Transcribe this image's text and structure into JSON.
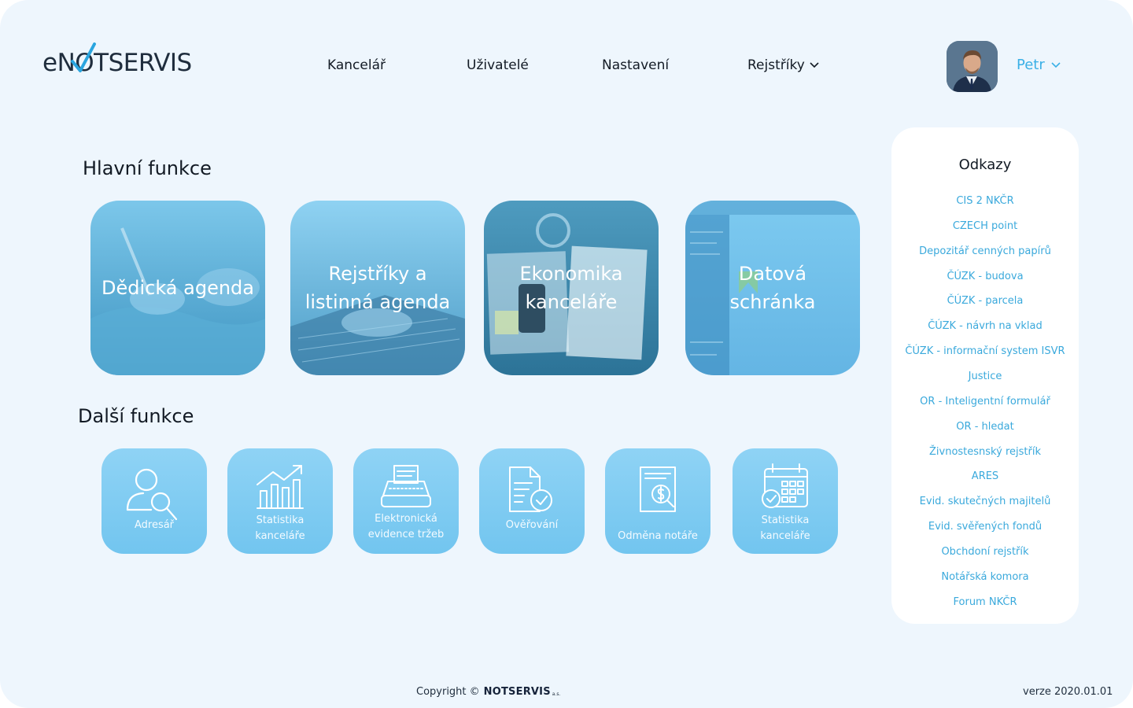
{
  "header": {
    "logo_text": "eNOTSERVIS",
    "nav": [
      {
        "label": "Kancelář"
      },
      {
        "label": "Uživatelé"
      },
      {
        "label": "Nastavení"
      },
      {
        "label": "Rejstříky"
      }
    ],
    "user_name": "Petr"
  },
  "main": {
    "primary_title": "Hlavní funkce",
    "primary_cards": [
      {
        "label": "Dědická agenda"
      },
      {
        "label": "Rejstříky a listinná agenda"
      },
      {
        "label": "Ekonomika kanceláře"
      },
      {
        "label": "Datová schránka"
      }
    ],
    "secondary_title": "Další funkce",
    "secondary_cards": [
      {
        "label": "Adresář",
        "icon": "address-book-search-icon"
      },
      {
        "label": "Statistika kanceláře",
        "icon": "growth-chart-icon"
      },
      {
        "label": "Elektronická evidence tržeb",
        "icon": "typewriter-icon"
      },
      {
        "label": "Ověřování",
        "icon": "document-check-icon"
      },
      {
        "label": "Odměna notáře",
        "icon": "invoice-dollar-icon"
      },
      {
        "label": "Statistika kanceláře",
        "icon": "calendar-check-icon"
      }
    ]
  },
  "links": {
    "title": "Odkazy",
    "items": [
      "CIS 2 NKČR",
      "CZECH point",
      "Depozitář cenných papírů",
      "ČÚZK - budova",
      "ČÚZK - parcela",
      "ČÚZK - návrh na vklad",
      "ČÚZK - informační system ISVR",
      "Justice",
      "OR - Inteligentní formulář",
      "OR - hledat",
      "Živnostesnský rejstřík",
      "ARES",
      "Evid. skutečných majitelů",
      "Evid. svěřených fondů",
      "Obchdoní rejstřík",
      "Notářská komora",
      "Forum NKČR"
    ]
  },
  "footer": {
    "copyright": "Copyright ©",
    "brand": "NOTSERVIS",
    "brand_suffix": "a.s.",
    "version": "verze 2020.01.01"
  },
  "colors": {
    "background": "#eef6fd",
    "accent": "#3ab0e6",
    "card_light": "#8fd3f5",
    "text_dark": "#121a24"
  }
}
